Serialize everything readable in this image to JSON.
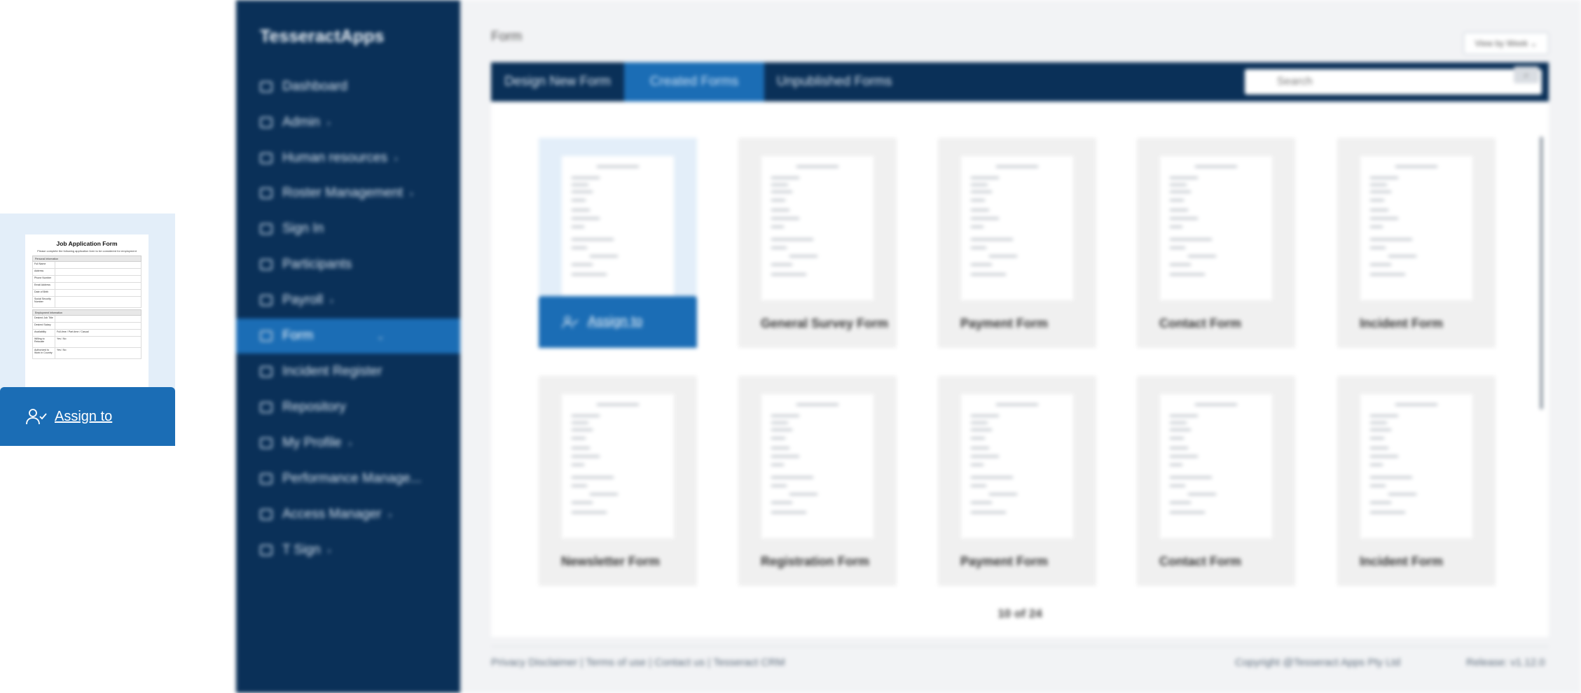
{
  "callout": {
    "doc_title": "Job Application Form",
    "doc_subtitle": "Please complete the following application form to be considered for employment",
    "section_personal": "Personal Information",
    "personal_fields": [
      "Full Name",
      "Address",
      "Phone Number",
      "Email Address",
      "Date of Birth",
      "Social Security Number"
    ],
    "section_employment": "Employment Information",
    "employment_fields": [
      {
        "label": "Desired Job Title",
        "value": ""
      },
      {
        "label": "Desired Salary",
        "value": ""
      },
      {
        "label": "Availability",
        "value": "Full-time / Part-time / Casual"
      },
      {
        "label": "Willing to Relocate",
        "value": "Yes / No"
      },
      {
        "label": "Authorized to Work in Country",
        "value": "Yes / No"
      }
    ],
    "assign_label": "Assign to"
  },
  "sidebar": {
    "brand": "TesseractApps",
    "items": [
      {
        "label": "Dashboard",
        "chevron": ""
      },
      {
        "label": "Admin",
        "chevron": "›"
      },
      {
        "label": "Human resources",
        "chevron": "›"
      },
      {
        "label": "Roster Management",
        "chevron": "›"
      },
      {
        "label": "Sign In",
        "chevron": ""
      },
      {
        "label": "Participants",
        "chevron": ""
      },
      {
        "label": "Payroll",
        "chevron": "›"
      },
      {
        "label": "Form",
        "chevron": "⌄"
      },
      {
        "label": "Incident Register",
        "chevron": ""
      },
      {
        "label": "Repository",
        "chevron": ""
      },
      {
        "label": "My Profile",
        "chevron": "›"
      },
      {
        "label": "Performance Manage...",
        "chevron": ""
      },
      {
        "label": "Access Manager",
        "chevron": "›"
      },
      {
        "label": "T Sign",
        "chevron": "›"
      }
    ]
  },
  "main": {
    "page_title": "Form",
    "view_select": "View by Week ⌄",
    "tabs": [
      "Design New Form",
      "Created Forms",
      "Unpublished Forms"
    ],
    "search_placeholder": "Search",
    "assign_label": "Assign to",
    "forms": [
      {
        "name": ""
      },
      {
        "name": "General Survey Form"
      },
      {
        "name": "Payment Form"
      },
      {
        "name": "Contact Form"
      },
      {
        "name": "Incident Form"
      },
      {
        "name": "Newsletter Form"
      },
      {
        "name": "Registration Form"
      },
      {
        "name": "Payment Form"
      },
      {
        "name": "Contact Form"
      },
      {
        "name": "Incident Form"
      }
    ],
    "pager": "10 of 24"
  },
  "footer": {
    "links": "Privacy Disclaimer | Terms of use | Contact us | Tesseract CRM",
    "copyright": "Copyright @Tesseract Apps Pty Ltd",
    "release": "Release: v1.12.0"
  },
  "colors": {
    "sidebar": "#0a3058",
    "accent": "#1b6db5",
    "background": "#f2f3f5"
  }
}
